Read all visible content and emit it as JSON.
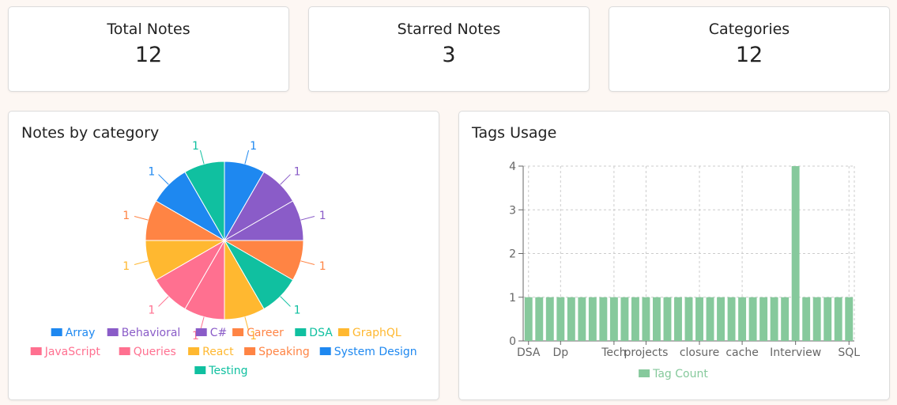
{
  "stats": {
    "total_notes": {
      "label": "Total Notes",
      "value": "12"
    },
    "starred_notes": {
      "label": "Starred Notes",
      "value": "3"
    },
    "categories": {
      "label": "Categories",
      "value": "12"
    }
  },
  "category_panel": {
    "title": "Notes by category"
  },
  "tags_panel": {
    "title": "Tags Usage"
  },
  "chart_data": [
    {
      "type": "pie",
      "title": "Notes by category",
      "legend": "bottom",
      "slices": [
        {
          "label": "Array",
          "value": 1,
          "color": "#1e88f0"
        },
        {
          "label": "Behavioral",
          "value": 1,
          "color": "#8a5cc8"
        },
        {
          "label": "C#",
          "value": 1,
          "color": "#8a5cc8"
        },
        {
          "label": "Career",
          "value": 1,
          "color": "#ff8444"
        },
        {
          "label": "DSA",
          "value": 1,
          "color": "#10c0a0"
        },
        {
          "label": "GraphQL",
          "value": 1,
          "color": "#ffb830"
        },
        {
          "label": "JavaScript",
          "value": 1,
          "color": "#ff7090"
        },
        {
          "label": "Queries",
          "value": 1,
          "color": "#ff7090"
        },
        {
          "label": "React",
          "value": 1,
          "color": "#ffb830"
        },
        {
          "label": "Speaking",
          "value": 1,
          "color": "#ff8444"
        },
        {
          "label": "System Design",
          "value": 1,
          "color": "#1e88f0"
        },
        {
          "label": "Testing",
          "value": 1,
          "color": "#10c0a0"
        }
      ]
    },
    {
      "type": "bar",
      "title": "Tags Usage",
      "series": [
        {
          "name": "Tag Count",
          "color": "#86c99c",
          "values": [
            1,
            1,
            1,
            1,
            1,
            1,
            1,
            1,
            1,
            1,
            1,
            1,
            1,
            1,
            1,
            1,
            1,
            1,
            1,
            1,
            1,
            1,
            1,
            1,
            1,
            4,
            1,
            1,
            1,
            1,
            1
          ]
        }
      ],
      "categories": [
        "DSA",
        "",
        "",
        "Dp",
        "",
        "",
        "",
        "",
        "Tech",
        "",
        "",
        "projects",
        "",
        "",
        "",
        "",
        "closure",
        "",
        "",
        "",
        "cache",
        "",
        "",
        "",
        "",
        "Interview",
        "",
        "",
        "",
        "",
        "SQL"
      ],
      "ylim": [
        0,
        4
      ],
      "yticks": [
        0,
        1,
        2,
        3,
        4
      ],
      "grid": true,
      "legend": "bottom"
    }
  ]
}
